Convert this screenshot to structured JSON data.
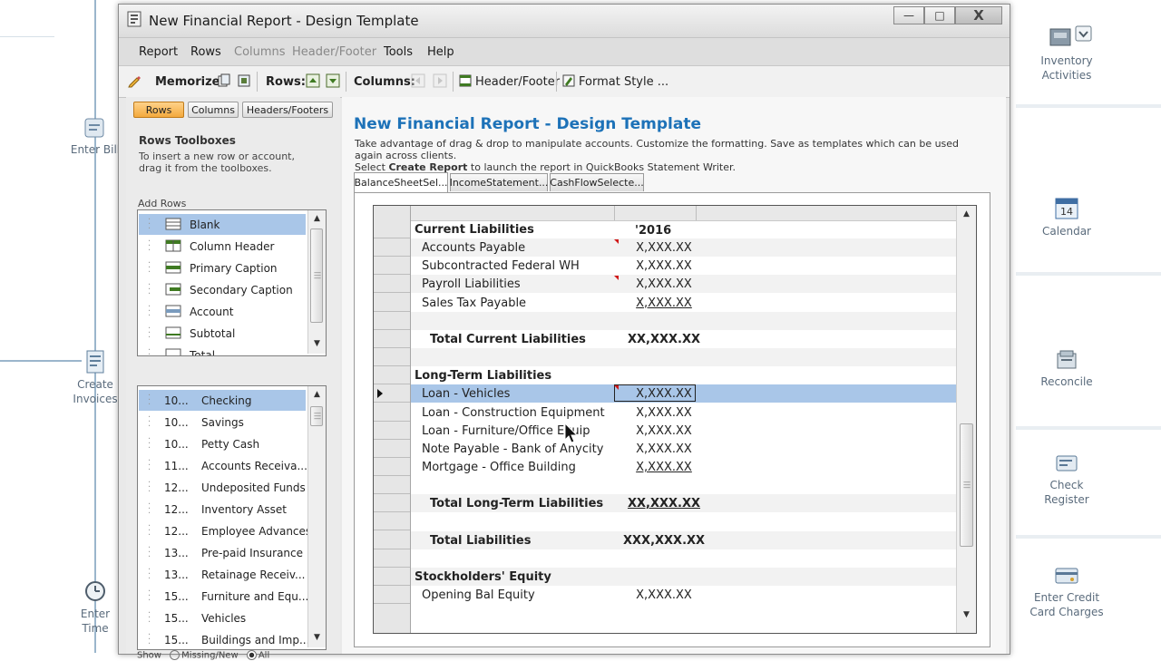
{
  "background": {
    "left_items": [
      {
        "label": "Enter Bill",
        "icon": "bill-icon"
      },
      {
        "label": "Create Invoices",
        "icon": "invoice-icon"
      },
      {
        "label": "Enter Time",
        "icon": "clock-icon"
      }
    ],
    "right_items": [
      {
        "label": "Inventory Activities",
        "icon": "inventory-icon"
      },
      {
        "label": "Calendar",
        "icon": "calendar-icon",
        "badge": "14"
      },
      {
        "label": "Reconcile",
        "icon": "reconcile-icon"
      },
      {
        "label": "Check Register",
        "icon": "check-register-icon"
      },
      {
        "label": "Enter Credit Card Charges",
        "icon": "credit-card-icon"
      }
    ]
  },
  "window": {
    "title": "New Financial Report - Design Template",
    "controls": {
      "minimize": "—",
      "maximize": "□",
      "close": "X"
    }
  },
  "menu": {
    "items": [
      {
        "label": "Report",
        "enabled": true
      },
      {
        "label": "Rows",
        "enabled": true
      },
      {
        "label": "Columns",
        "enabled": false
      },
      {
        "label": "Header/Footer",
        "enabled": false
      },
      {
        "label": "Tools",
        "enabled": true
      },
      {
        "label": "Help",
        "enabled": true
      }
    ]
  },
  "toolbar": {
    "memorize_label": "Memorize:",
    "rows_label": "Rows:",
    "columns_label": "Columns:",
    "header_footer_label": "Header/Footer",
    "format_style_label": "Format Style ..."
  },
  "left_panel": {
    "tabs": [
      {
        "label": "Rows",
        "active": true
      },
      {
        "label": "Columns",
        "active": false
      },
      {
        "label": "Headers/Footers",
        "active": false
      }
    ],
    "title": "Rows Toolboxes",
    "description": "To insert a new row or account, drag it from the toolboxes.",
    "add_rows_label": "Add Rows",
    "row_types": [
      {
        "label": "Blank",
        "selected": true
      },
      {
        "label": "Column Header",
        "selected": false
      },
      {
        "label": "Primary Caption",
        "selected": false
      },
      {
        "label": "Secondary Caption",
        "selected": false
      },
      {
        "label": "Account",
        "selected": false
      },
      {
        "label": "Subtotal",
        "selected": false
      },
      {
        "label": "Total",
        "selected": false
      }
    ],
    "accounts": [
      {
        "number": "10...",
        "name": "Checking",
        "selected": true
      },
      {
        "number": "10...",
        "name": "Savings",
        "selected": false
      },
      {
        "number": "10...",
        "name": "Petty Cash",
        "selected": false
      },
      {
        "number": "11...",
        "name": "Accounts Receiva...",
        "selected": false
      },
      {
        "number": "12...",
        "name": "Undeposited Funds",
        "selected": false
      },
      {
        "number": "12...",
        "name": "Inventory Asset",
        "selected": false
      },
      {
        "number": "12...",
        "name": "Employee Advances",
        "selected": false
      },
      {
        "number": "13...",
        "name": "Pre-paid Insurance",
        "selected": false
      },
      {
        "number": "13...",
        "name": "Retainage Receiv...",
        "selected": false
      },
      {
        "number": "15...",
        "name": "Furniture and Equ...",
        "selected": false
      },
      {
        "number": "15...",
        "name": "Vehicles",
        "selected": false
      },
      {
        "number": "15...",
        "name": "Buildings and Imp...",
        "selected": false
      }
    ],
    "show_label": "Show",
    "show_options": [
      "Missing/New",
      "All"
    ]
  },
  "main": {
    "title": "New Financial Report - Design Template",
    "desc_line1": "Take advantage of drag & drop to manipulate accounts. Customize the formatting. Save as templates which can be used again across clients.",
    "desc_line2_pre": "Select ",
    "desc_line2_bold": "Create Report",
    "desc_line2_post": " to launch the report in QuickBooks Statement Writer.",
    "report_tabs": [
      {
        "label": "BalanceSheetSel...",
        "active": true
      },
      {
        "label": "IncomeStatement...",
        "active": false
      },
      {
        "label": "CashFlowSelecte...",
        "active": false
      }
    ],
    "column_header": "'2016",
    "rows": [
      {
        "label": "Current Liabilities",
        "amount": "",
        "style": "caption"
      },
      {
        "label": "Accounts Payable",
        "amount": "X,XXX.XX",
        "style": "account",
        "flag": true
      },
      {
        "label": "Subcontracted Federal WH",
        "amount": "X,XXX.XX",
        "style": "account"
      },
      {
        "label": "Payroll Liabilities",
        "amount": "X,XXX.XX",
        "style": "account",
        "flag": true
      },
      {
        "label": "Sales Tax Payable",
        "amount": "X,XXX.XX",
        "style": "account",
        "underline": true
      },
      {
        "label": "",
        "amount": "",
        "style": "blank"
      },
      {
        "label": "Total Current Liabilities",
        "amount": "XX,XXX.XX",
        "style": "total"
      },
      {
        "label": "",
        "amount": "",
        "style": "blank"
      },
      {
        "label": "Long-Term Liabilities",
        "amount": "",
        "style": "caption"
      },
      {
        "label": "Loan - Vehicles",
        "amount": "X,XXX.XX",
        "style": "account",
        "selected": true,
        "flag": true
      },
      {
        "label": "Loan - Construction Equipment",
        "amount": "X,XXX.XX",
        "style": "account"
      },
      {
        "label": "Loan - Furniture/Office Equip",
        "amount": "X,XXX.XX",
        "style": "account"
      },
      {
        "label": "Note Payable - Bank of Anycity",
        "amount": "X,XXX.XX",
        "style": "account"
      },
      {
        "label": "Mortgage - Office Building",
        "amount": "X,XXX.XX",
        "style": "account",
        "underline": true
      },
      {
        "label": "",
        "amount": "",
        "style": "blank"
      },
      {
        "label": "Total Long-Term Liabilities",
        "amount": "XX,XXX.XX",
        "style": "total",
        "underline": true
      },
      {
        "label": "",
        "amount": "",
        "style": "blank"
      },
      {
        "label": "Total Liabilities",
        "amount": "XXX,XXX.XX",
        "style": "total"
      },
      {
        "label": "",
        "amount": "",
        "style": "blank"
      },
      {
        "label": "Stockholders' Equity",
        "amount": "",
        "style": "caption"
      },
      {
        "label": "Opening Bal Equity",
        "amount": "X,XXX.XX",
        "style": "account"
      }
    ]
  }
}
